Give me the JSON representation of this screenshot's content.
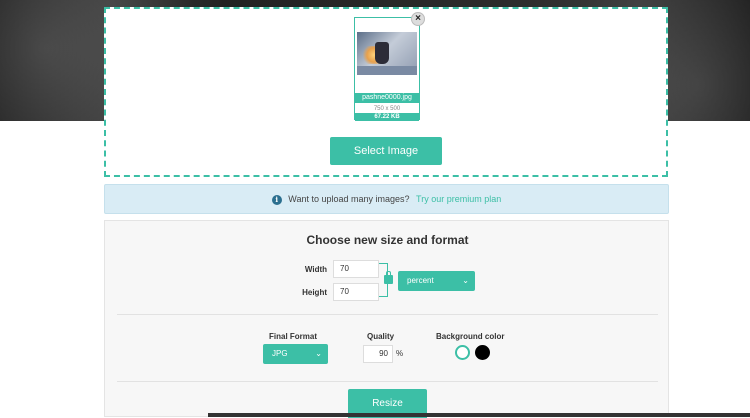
{
  "upload": {
    "file_name": "pashne0000.jpg",
    "dimensions": "750 x 500",
    "file_size": "67.22 KB",
    "close_glyph": "×",
    "select_button": "Select Image"
  },
  "info": {
    "icon_glyph": "i",
    "text": "Want to upload many images?",
    "link": "Try our premium plan"
  },
  "options": {
    "title": "Choose new size and format",
    "width_label": "Width",
    "width_value": "70",
    "height_label": "Height",
    "height_value": "70",
    "unit": "percent",
    "format_label": "Final Format",
    "format_value": "JPG",
    "quality_label": "Quality",
    "quality_value": "90",
    "quality_unit": "%",
    "bg_label": "Background color",
    "resize_button": "Resize"
  },
  "colors": {
    "accent": "#3cbfa6",
    "swatch_white": "#ffffff",
    "swatch_black": "#000000"
  },
  "icons": {
    "close": "close-icon",
    "info": "info-icon",
    "lock": "lock-icon",
    "chevron": "chevron-down-icon"
  }
}
